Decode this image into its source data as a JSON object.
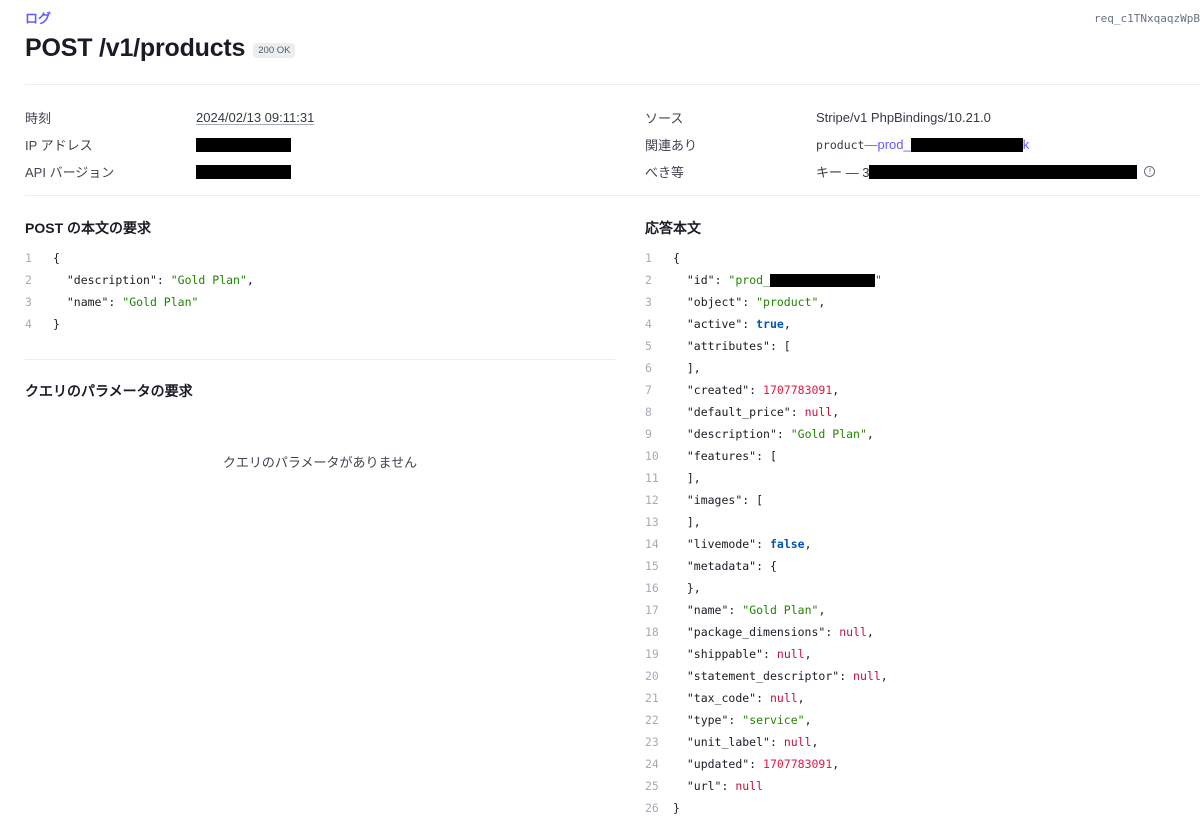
{
  "breadcrumb": "ログ",
  "request_id": "req_c1TNxqaqzWpB",
  "title": "POST /v1/products",
  "status_badge": "200 OK",
  "meta_left": [
    {
      "label": "時刻",
      "value": "2024/02/13 09:11:31"
    },
    {
      "label": "IP アドレス",
      "value": ""
    },
    {
      "label": "API バージョン",
      "value": ""
    }
  ],
  "meta_right": {
    "source_label": "ソース",
    "source_value": "Stripe/v1 PhpBindings/10.21.0",
    "related_label": "関連あり",
    "related_object": "product",
    "related_sep": " — ",
    "related_link_prefix": "prod_",
    "related_link_suffix": "k",
    "idempotency_label": "べき等",
    "idempotency_value": "キー — 3"
  },
  "request_body_title": "POST の本文の要求",
  "request_body_lines": [
    "{",
    "  \"description\": \"Gold Plan\",",
    "  \"name\": \"Gold Plan\"",
    "}"
  ],
  "query_params_title": "クエリのパラメータの要求",
  "query_params_empty": "クエリのパラメータがありません",
  "response_body_title": "応答本文",
  "response_body_lines": [
    "{",
    "  \"id\": \"prod_██████████████\"",
    "  \"object\": \"product\",",
    "  \"active\": true,",
    "  \"attributes\": [",
    "  ],",
    "  \"created\": 1707783091,",
    "  \"default_price\": null,",
    "  \"description\": \"Gold Plan\",",
    "  \"features\": [",
    "  ],",
    "  \"images\": [",
    "  ],",
    "  \"livemode\": false,",
    "  \"metadata\": {",
    "  },",
    "  \"name\": \"Gold Plan\",",
    "  \"package_dimensions\": null,",
    "  \"shippable\": null,",
    "  \"statement_descriptor\": null,",
    "  \"tax_code\": null,",
    "  \"type\": \"service\",",
    "  \"unit_label\": null,",
    "  \"updated\": 1707783091,",
    "  \"url\": null",
    "}"
  ],
  "colors": {
    "accent": "#635bff",
    "string": "#228403",
    "number": "#df1b41",
    "null": "#c0123c",
    "boolean": "#0055bc"
  }
}
